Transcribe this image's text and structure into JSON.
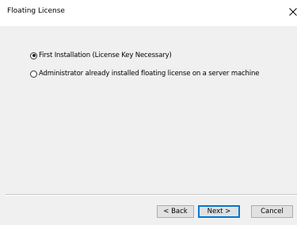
{
  "window": {
    "title": "Floating License"
  },
  "icons": {
    "close": "close-icon"
  },
  "options": [
    {
      "label": "First Installation (License Key Necessary)",
      "selected": true
    },
    {
      "label": "Administrator already installed floating license on a server machine",
      "selected": false
    }
  ],
  "buttons": {
    "back": "< Back",
    "next": "Next >",
    "cancel": "Cancel"
  },
  "colors": {
    "titlebar_bg": "#ffffff",
    "dialog_bg": "#f0f0f0",
    "button_bg": "#e1e1e1",
    "default_button_border": "#0078d7"
  }
}
